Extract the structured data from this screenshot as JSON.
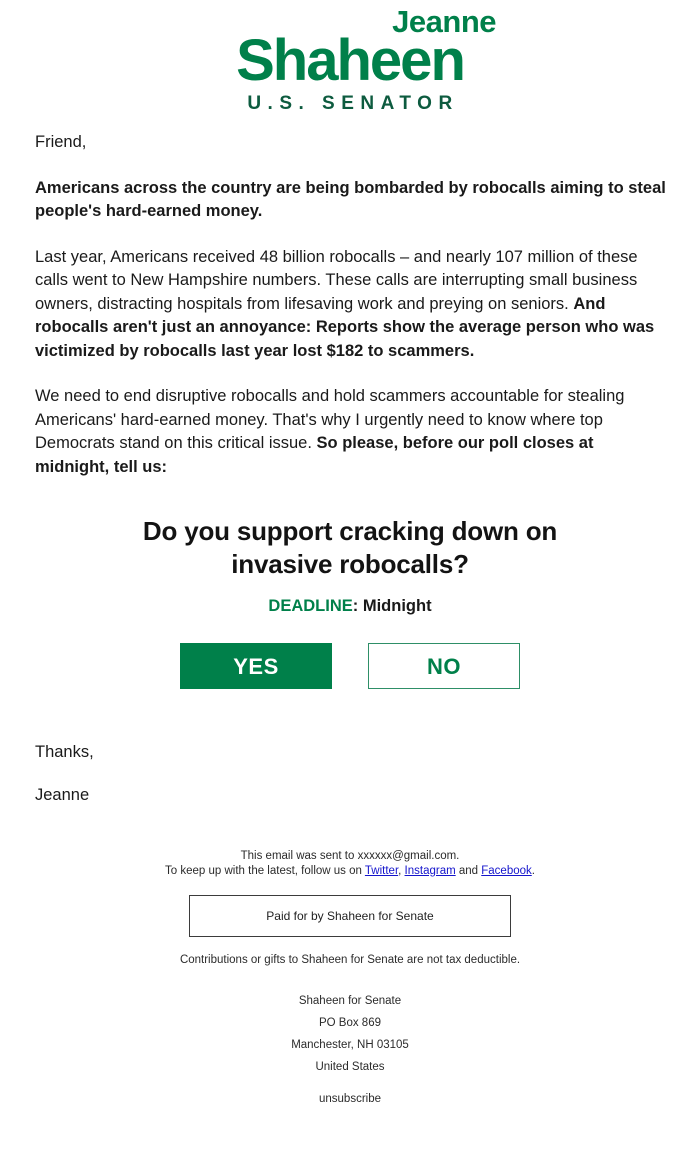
{
  "logo": {
    "first_name": "Jeanne",
    "last_name": "Shaheen",
    "title": "U.S. SENATOR",
    "brand_green": "#00804a",
    "title_green": "#0d5b3f"
  },
  "body": {
    "greeting": "Friend,",
    "p1_bold": "Americans across the country are being bombarded by robocalls aiming to steal people's hard-earned money.",
    "p2_plain": "Last year, Americans received 48 billion robocalls – and nearly 107 million of these calls went to New Hampshire numbers. These calls are interrupting small business owners, distracting hospitals from lifesaving work and preying on seniors. ",
    "p2_bold": "And robocalls aren't just an annoyance: Reports show the average person who was victimized by robocalls last year lost $182 to scammers.",
    "p3_plain": "We need to end disruptive robocalls and hold scammers accountable for stealing Americans' hard-earned money. That's why I urgently need to know where top Democrats stand on this critical issue. ",
    "p3_bold": "So please, before our poll closes at midnight, tell us:"
  },
  "poll": {
    "question": "Do you support cracking down on invasive robocalls?",
    "deadline_label": "DEADLINE",
    "deadline_value": ": Midnight",
    "yes_label": "YES",
    "no_label": "NO"
  },
  "signoff": {
    "closing": "Thanks,",
    "name": "Jeanne"
  },
  "footer": {
    "sent_to_prefix": "This email was sent to ",
    "sent_to_email": "xxxxxx@gmail.com",
    "sent_to_suffix": ".",
    "follow_prefix": "To keep up with the latest, follow us on ",
    "link_twitter": "Twitter",
    "follow_sep1": ", ",
    "link_instagram": "Instagram",
    "follow_sep2": " and ",
    "link_facebook": "Facebook",
    "follow_suffix": ".",
    "paid_for": "Paid for by Shaheen for Senate",
    "disclaimer": "Contributions or gifts to Shaheen for Senate are not tax deductible.",
    "address": [
      "Shaheen for Senate",
      "PO Box 869",
      "Manchester, NH 03105",
      "United States"
    ],
    "unsubscribe": "unsubscribe",
    "link_color": "#1414cc"
  }
}
